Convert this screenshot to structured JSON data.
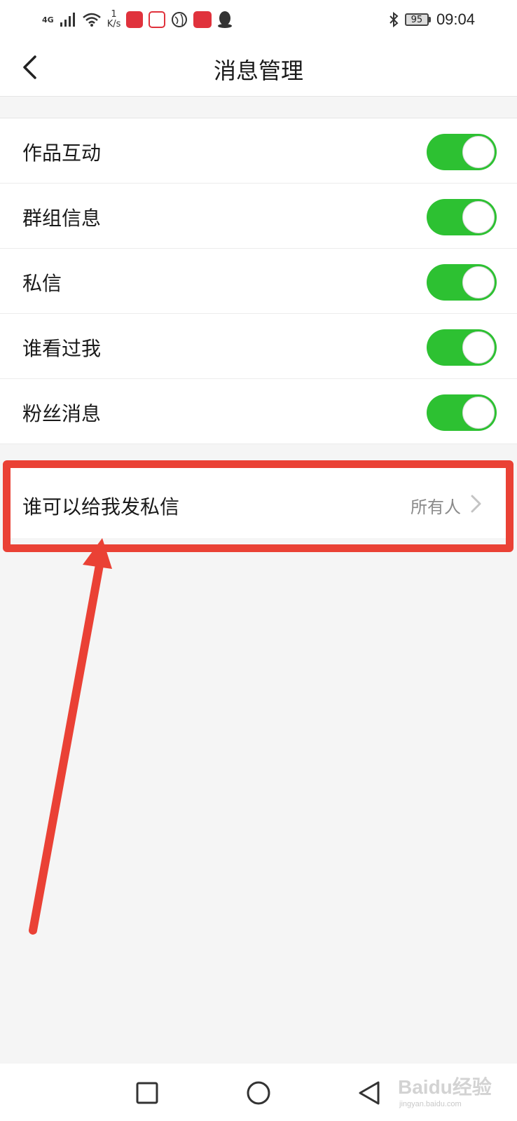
{
  "status_bar": {
    "network": "4G",
    "speed_value": "1",
    "speed_unit": "K/s",
    "battery": "95",
    "time": "09:04",
    "icons": [
      "signal-icon",
      "wifi-icon",
      "app-notification-icons",
      "qq-icon",
      "bluetooth-icon"
    ]
  },
  "header": {
    "title": "消息管理",
    "back_icon": "chevron-left-icon"
  },
  "settings": [
    {
      "label": "作品互动",
      "enabled": true
    },
    {
      "label": "群组信息",
      "enabled": true
    },
    {
      "label": "私信",
      "enabled": true
    },
    {
      "label": "谁看过我",
      "enabled": true
    },
    {
      "label": "粉丝消息",
      "enabled": true
    }
  ],
  "dm_permission": {
    "label": "谁可以给我发私信",
    "value": "所有人",
    "icon": "chevron-right-icon"
  },
  "annotation": {
    "color": "#ea4135"
  },
  "colors": {
    "toggle_on": "#2dc132",
    "background": "#f5f5f5"
  },
  "nav_bar": {
    "icons": [
      "recent-apps-icon",
      "home-icon",
      "back-triangle-icon"
    ]
  },
  "watermark": {
    "main": "Baidu经验",
    "sub": "jingyan.baidu.com"
  }
}
